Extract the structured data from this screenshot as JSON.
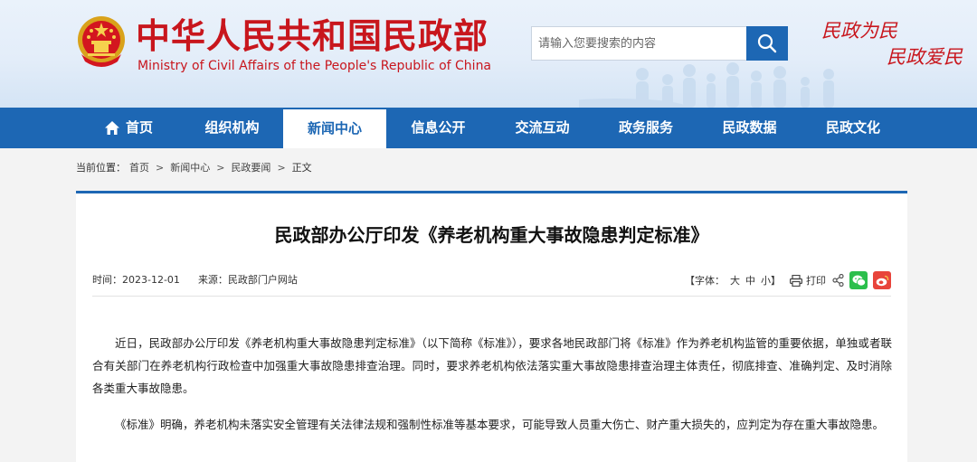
{
  "header": {
    "title_cn": "中华人民共和国民政部",
    "title_en": "Ministry of Civil Affairs of the People's Republic of China",
    "search_placeholder": "请输入您要搜索的内容",
    "slogan_line1": "民政为民",
    "slogan_line2": "民政爱民",
    "brand_red": "#c8161d",
    "brand_blue": "#1d67b4"
  },
  "nav": {
    "items": [
      {
        "label": "首页",
        "icon": "home-icon"
      },
      {
        "label": "组织机构"
      },
      {
        "label": "新闻中心",
        "active": true
      },
      {
        "label": "信息公开"
      },
      {
        "label": "交流互动"
      },
      {
        "label": "政务服务"
      },
      {
        "label": "民政数据"
      },
      {
        "label": "民政文化"
      }
    ]
  },
  "breadcrumb": {
    "prefix": "当前位置：",
    "items": [
      "首页",
      "新闻中心",
      "民政要闻",
      "正文"
    ],
    "separator": ">"
  },
  "article": {
    "title": "民政部办公厅印发《养老机构重大事故隐患判定标准》",
    "date_label": "时间：",
    "date": "2023-12-01",
    "source_label": "来源：",
    "source": "民政部门户网站",
    "font_label": "【字体：",
    "font_large": "大",
    "font_medium": "中",
    "font_small": "小",
    "font_close": "】",
    "print_label": "打印",
    "paragraphs": [
      "近日，民政部办公厅印发《养老机构重大事故隐患判定标准》（以下简称《标准》），要求各地民政部门将《标准》作为养老机构监管的重要依据，单独或者联合有关部门在养老机构行政检查中加强重大事故隐患排查治理。同时，要求养老机构依法落实重大事故隐患排查治理主体责任，彻底排查、准确判定、及时消除各类重大事故隐患。",
      "《标准》明确，养老机构未落实安全管理有关法律法规和强制性标准等基本要求，可能导致人员重大伤亡、财产重大损失的，应判定为存在重大事故隐患。"
    ]
  }
}
